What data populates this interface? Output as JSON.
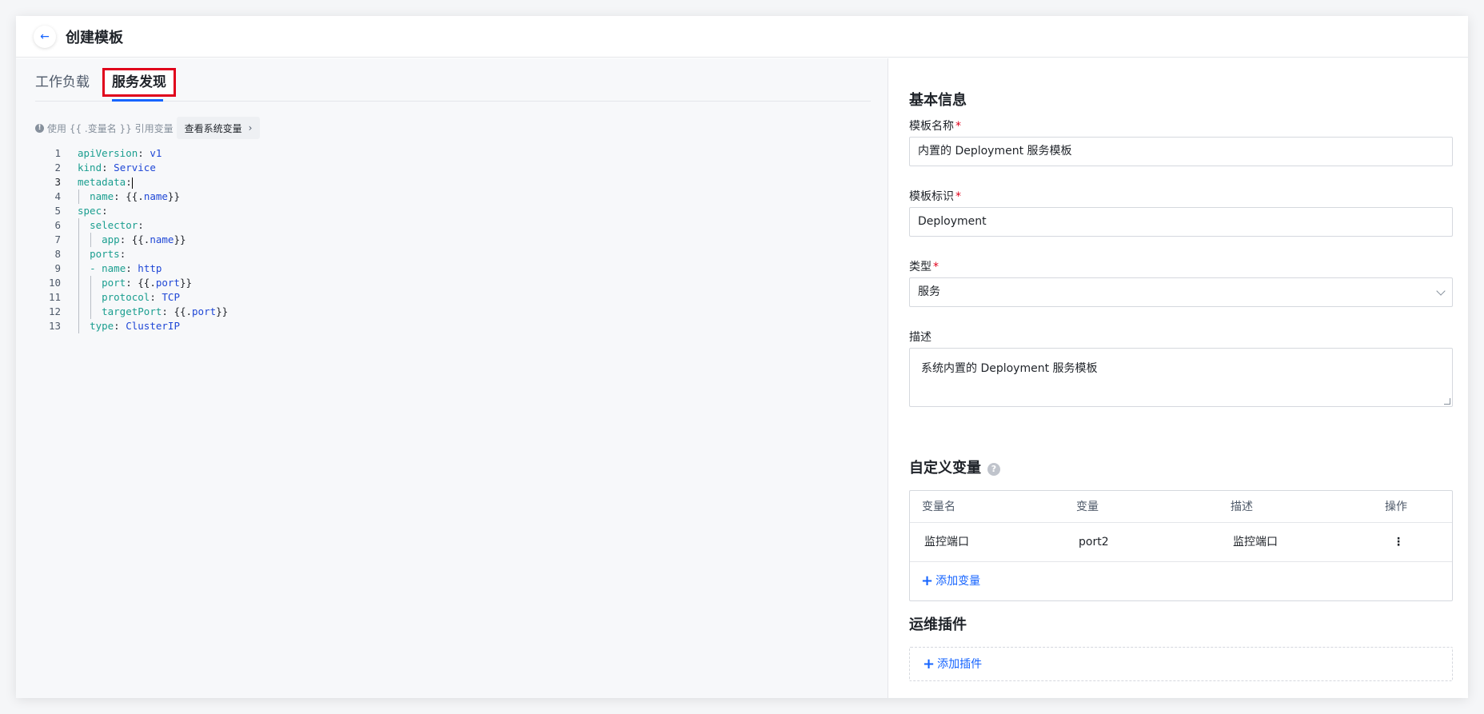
{
  "header": {
    "title": "创建模板",
    "back_icon": "arrow-left-icon"
  },
  "tabs": [
    {
      "label": "工作负载",
      "active": false
    },
    {
      "label": "服务发现",
      "active": true
    }
  ],
  "hint": {
    "text": "使用 {{ .变量名 }} 引用变量",
    "button_label": "查看系统变量"
  },
  "editor": {
    "lines": [
      "1",
      "2",
      "3",
      "4",
      "5",
      "6",
      "7",
      "8",
      "9",
      "10",
      "11",
      "12",
      "13"
    ],
    "code": [
      {
        "key": "apiVersion",
        "sep": ": ",
        "val": "v1"
      },
      {
        "key": "kind",
        "sep": ": ",
        "val": "Service"
      },
      {
        "key": "metadata",
        "sep": ":",
        "val": ""
      },
      {
        "indent": "  ",
        "key": "name",
        "sep": ": ",
        "pre": "{{.",
        "val": "name",
        "post": "}}"
      },
      {
        "key": "spec",
        "sep": ":",
        "val": ""
      },
      {
        "indent": "  ",
        "key": "selector",
        "sep": ":",
        "val": ""
      },
      {
        "indent": "    ",
        "key": "app",
        "sep": ": ",
        "pre": "{{.",
        "val": "name",
        "post": "}}"
      },
      {
        "indent": "  ",
        "key": "ports",
        "sep": ":",
        "val": ""
      },
      {
        "indent": "  ",
        "dash": "- ",
        "key": "name",
        "sep": ": ",
        "val": "http"
      },
      {
        "indent": "    ",
        "key": "port",
        "sep": ": ",
        "pre": "{{.",
        "val": "port",
        "post": "}}"
      },
      {
        "indent": "    ",
        "key": "protocol",
        "sep": ": ",
        "val": "TCP"
      },
      {
        "indent": "    ",
        "key": "targetPort",
        "sep": ": ",
        "pre": "{{.",
        "val": "port",
        "post": "}}"
      },
      {
        "indent": "  ",
        "key": "type",
        "sep": ": ",
        "val": "ClusterIP"
      }
    ]
  },
  "basic": {
    "title": "基本信息",
    "name_label": "模板名称",
    "name_value": "内置的 Deployment 服务模板",
    "id_label": "模板标识",
    "id_value": "Deployment",
    "type_label": "类型",
    "type_value": "服务",
    "desc_label": "描述",
    "desc_value": "系统内置的 Deployment 服务模板",
    "required_mark": "*"
  },
  "vars": {
    "title": "自定义变量",
    "help": "?",
    "columns": [
      "变量名",
      "变量",
      "描述",
      "操作"
    ],
    "rows": [
      {
        "name": "监控端口",
        "var": "port2",
        "desc": "监控端口",
        "action": "⋮"
      }
    ],
    "add_label": "添加变量"
  },
  "plugins": {
    "title": "运维插件",
    "add_label": "添加插件"
  },
  "colors": {
    "accent": "#1664ff",
    "highlight_border": "#e0001b",
    "required": "#e0001b"
  }
}
